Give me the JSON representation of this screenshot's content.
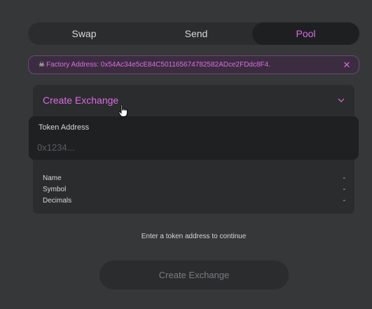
{
  "tabs": [
    {
      "label": "Swap",
      "active": false
    },
    {
      "label": "Send",
      "active": false
    },
    {
      "label": "Pool",
      "active": true
    }
  ],
  "banner": {
    "icon": "skull-icon",
    "text": "Factory Address: 0x54Ac34e5cE84C501165674782582ADce2FDdc8F4.",
    "close_icon": "close-icon"
  },
  "panel": {
    "title": "Create Exchange",
    "chevron_icon": "chevron-down-icon"
  },
  "token_input": {
    "label": "Token Address",
    "value": "",
    "placeholder": "0x1234..."
  },
  "details": [
    {
      "label": "Name",
      "value": "-"
    },
    {
      "label": "Symbol",
      "value": "-"
    },
    {
      "label": "Decimals",
      "value": "-"
    }
  ],
  "hint": "Enter a token address to continue",
  "create_button": {
    "label": "Create Exchange",
    "disabled": true
  },
  "colors": {
    "accent": "#dc6be5",
    "background": "#353738",
    "panel": "#2b2c2e",
    "input": "#1f2022"
  }
}
